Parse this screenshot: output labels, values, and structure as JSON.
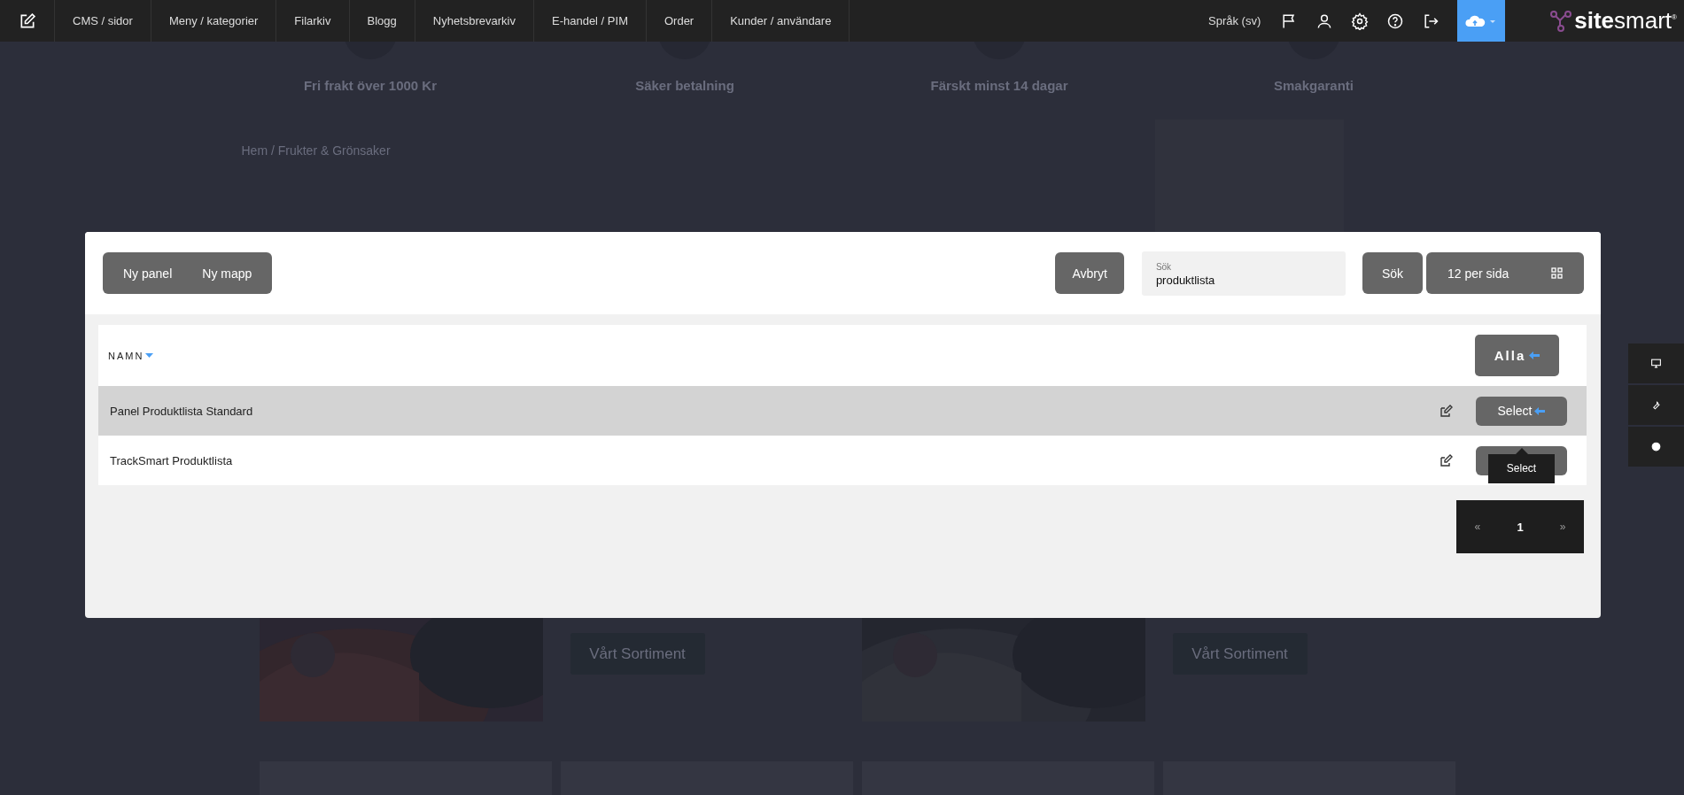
{
  "top_nav": {
    "items": [
      "CMS / sidor",
      "Meny / kategorier",
      "Filarkiv",
      "Blogg",
      "Nyhetsbrevarkiv",
      "E-handel / PIM",
      "Order",
      "Kunder / användare"
    ],
    "language": "Språk (sv)",
    "logo": "**site**smart$^{®}$"
  },
  "background": {
    "features": [
      "Fri frakt över 1000 Kr",
      "Säker betalning",
      "Färskt minst 14 dagar",
      "Smakgaranti"
    ],
    "breadcrumb": "Hem / Frukter & Grönsaker",
    "promo_buttons": [
      "Vårt Sortiment",
      "Vårt Sortiment"
    ]
  },
  "modal": {
    "toolbar_buttons": [
      "Ny panel",
      "Ny mapp"
    ],
    "cancel": "Avbryt",
    "search": {
      "label": "Sök",
      "value": "produktlista"
    },
    "search_button": "Sök",
    "per_page": "12 per sida",
    "table": {
      "column": "NAMN",
      "all_button": "Alla",
      "rows": [
        {
          "name": "Panel Produktlista Standard",
          "selected": true,
          "select_label": "Select"
        },
        {
          "name": "TrackSmart Produktlista",
          "selected": false
        }
      ]
    },
    "tooltip": "Select",
    "pagination": [
      {
        "label": "«",
        "selected": false
      },
      {
        "label": "1",
        "selected": true
      },
      {
        "label": "»",
        "selected": false
      }
    ]
  }
}
